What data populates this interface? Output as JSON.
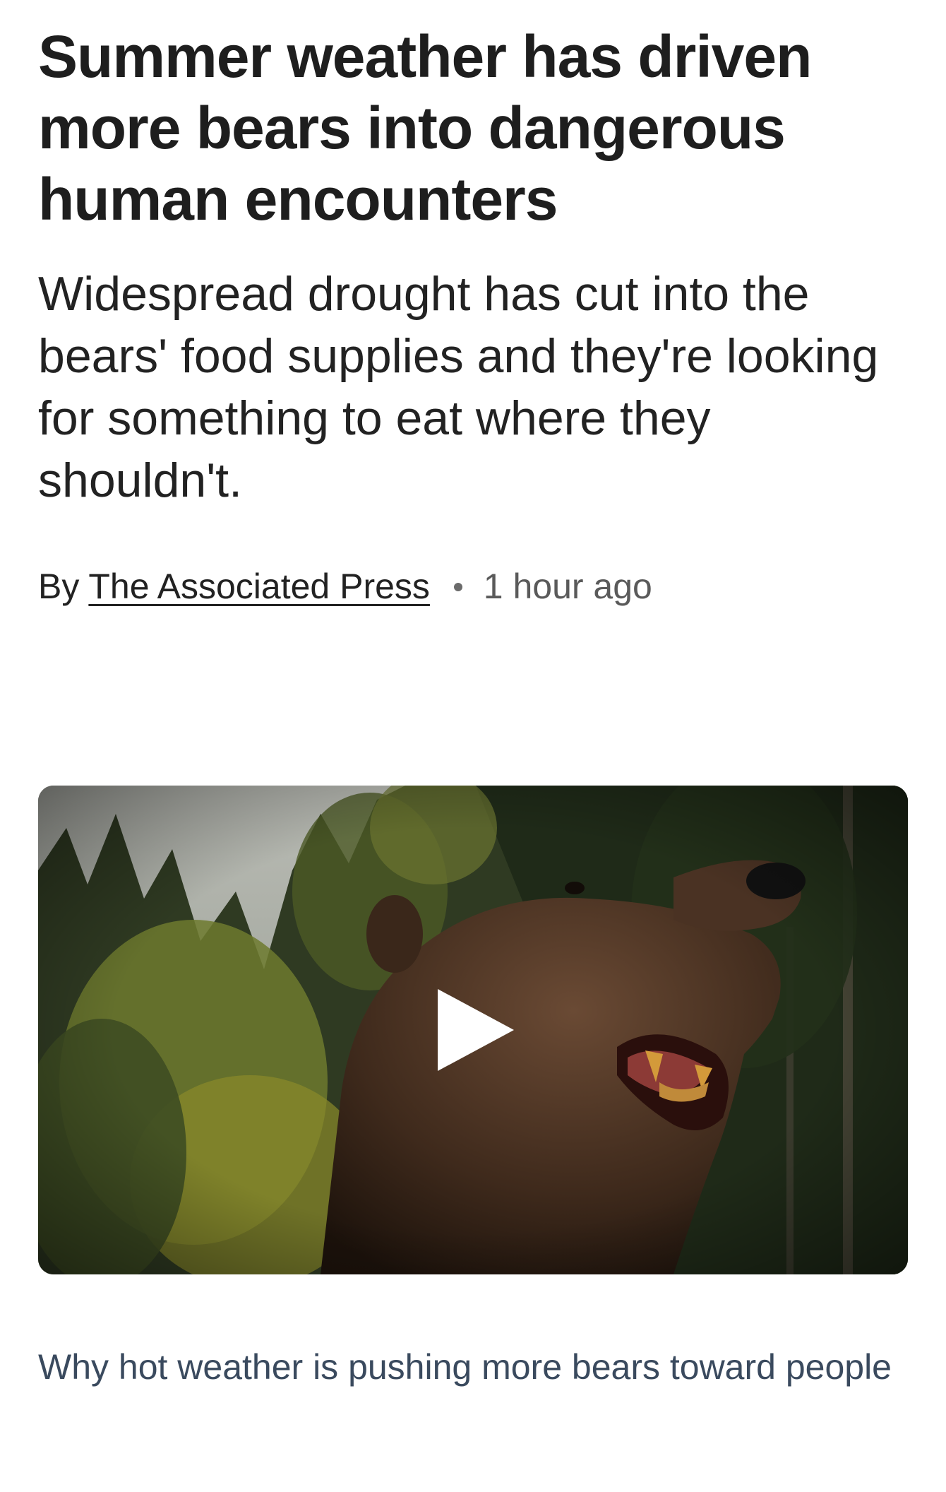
{
  "article": {
    "headline": "Summer weather has driven more bears into dangerous human encounters",
    "dek": "Widespread drought has cut into the bears' food supplies and they're looking for something to eat where they shouldn't.",
    "byline": {
      "prefix": "By",
      "author": "The Associated Press",
      "time": "1 hour ago"
    },
    "video": {
      "caption": "Why hot weather is pushing more bears toward people",
      "play_icon": "play-icon"
    }
  },
  "colors": {
    "headline": "#1e1e1e",
    "body_text": "#222222",
    "time_text": "#5a5a5a",
    "caption_text": "#3a4a5e",
    "background": "#ffffff"
  }
}
